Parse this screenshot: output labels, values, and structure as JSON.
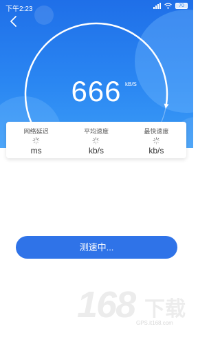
{
  "status_bar": {
    "time": "下午2:23",
    "battery": "70",
    "icons": [
      "signal-icon",
      "wifi-icon",
      "battery-icon"
    ]
  },
  "header": {
    "back_icon": "chevron-left-icon"
  },
  "gauge": {
    "value": "666",
    "unit": "kB/S",
    "progress": 0.83
  },
  "stats": [
    {
      "label": "网络延迟",
      "unit": "ms",
      "icon": "loading-spinner-icon"
    },
    {
      "label": "平均速度",
      "unit": "kb/s",
      "icon": "loading-spinner-icon"
    },
    {
      "label": "最快速度",
      "unit": "kb/s",
      "icon": "loading-spinner-icon"
    }
  ],
  "action_button": {
    "label": "测速中..."
  },
  "watermark": {
    "brand": "168下载",
    "url": "GPS.it168.com"
  },
  "colors": {
    "primary_blue": "#2a80ee",
    "button_blue": "#2f73e8",
    "text_dark": "#333333"
  }
}
